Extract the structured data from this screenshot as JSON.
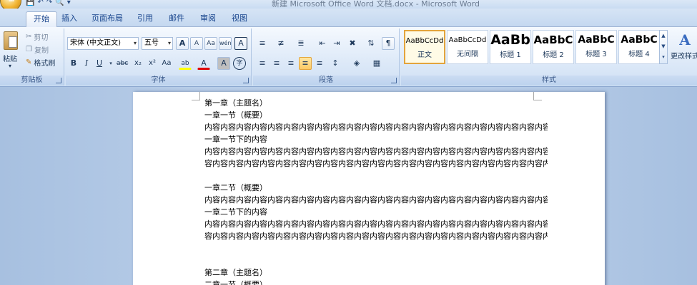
{
  "window": {
    "title": "新建 Microsoft Office Word 文档.docx - Microsoft Word",
    "orb_icon": "office-logo"
  },
  "quick_access": {
    "save_icon": "save-icon",
    "undo_icon": "undo-icon",
    "redo_icon": "redo-icon",
    "print_icon": "print-preview-icon"
  },
  "tabs": [
    "开始",
    "插入",
    "页面布局",
    "引用",
    "邮件",
    "审阅",
    "视图"
  ],
  "ribbon": {
    "clipboard": {
      "label": "剪贴板",
      "paste": "粘贴",
      "cut": "剪切",
      "copy": "复制",
      "format_painter": "格式刷"
    },
    "font": {
      "label": "字体",
      "font_name": "宋体 (中文正文)",
      "font_size": "五号",
      "grow": "A",
      "shrink": "A",
      "clear_format": "Aa",
      "phonetic": "wén",
      "char_border": "A",
      "bold": "B",
      "italic": "I",
      "underline": "U",
      "strike": "abc",
      "subscript": "x₂",
      "superscript": "x²",
      "change_case": "Aa",
      "highlight": "ab",
      "font_color": "A",
      "char_shading": "A",
      "enclose": "字"
    },
    "paragraph": {
      "label": "段落"
    },
    "styles": {
      "label": "样式",
      "change_styles": "更改样式",
      "tiles": [
        {
          "sample": "AaBbCcDd",
          "name": "正文",
          "size": "10px",
          "weight": "normal"
        },
        {
          "sample": "AaBbCcDd",
          "name": "无间隔",
          "size": "10px",
          "weight": "normal"
        },
        {
          "sample": "AaBb",
          "name": "标题 1",
          "size": "20px",
          "weight": "bold"
        },
        {
          "sample": "AaBbC",
          "name": "标题 2",
          "size": "16px",
          "weight": "bold"
        },
        {
          "sample": "AaBbC",
          "name": "标题 3",
          "size": "15px",
          "weight": "bold"
        },
        {
          "sample": "AaBbC",
          "name": "标题 4",
          "size": "15px",
          "weight": "bold"
        }
      ]
    }
  },
  "document": {
    "lines": [
      "第一章（主题名）",
      "一章一节（概要）",
      "内容内容内容内容内容内容内容内容内容内容内容内容内容内容内容内容内容内容内容内容内容内容内容内容",
      "一章一节下的内容",
      "内容内容内容内容内容内容内容内容内容内容内容内容内容内容内容内容内容内容内容内容内容内容内容内容",
      "容内容内容内容内容内容内容内容内容内容内容内容内容内容内容内容内容内容内容内容内容内容内容内容",
      "",
      "一章二节（概要）",
      "内容内容内容内容内容内容内容内容内容内容内容内容内容内容内容内容内容内容内容内容内容内容内容内容",
      "一章二节下的内容",
      "内容内容内容内容内容内容内容内容内容内容内容内容内容内容内容内容内容内容内容内容内容内容内容内容",
      "容内容内容内容内容内容内容内容内容内容内容内容内容内容内容内容内容内容内容内容内容内容内容内容",
      "",
      "",
      "第二章（主题名）",
      "二章一节（概要）"
    ]
  }
}
